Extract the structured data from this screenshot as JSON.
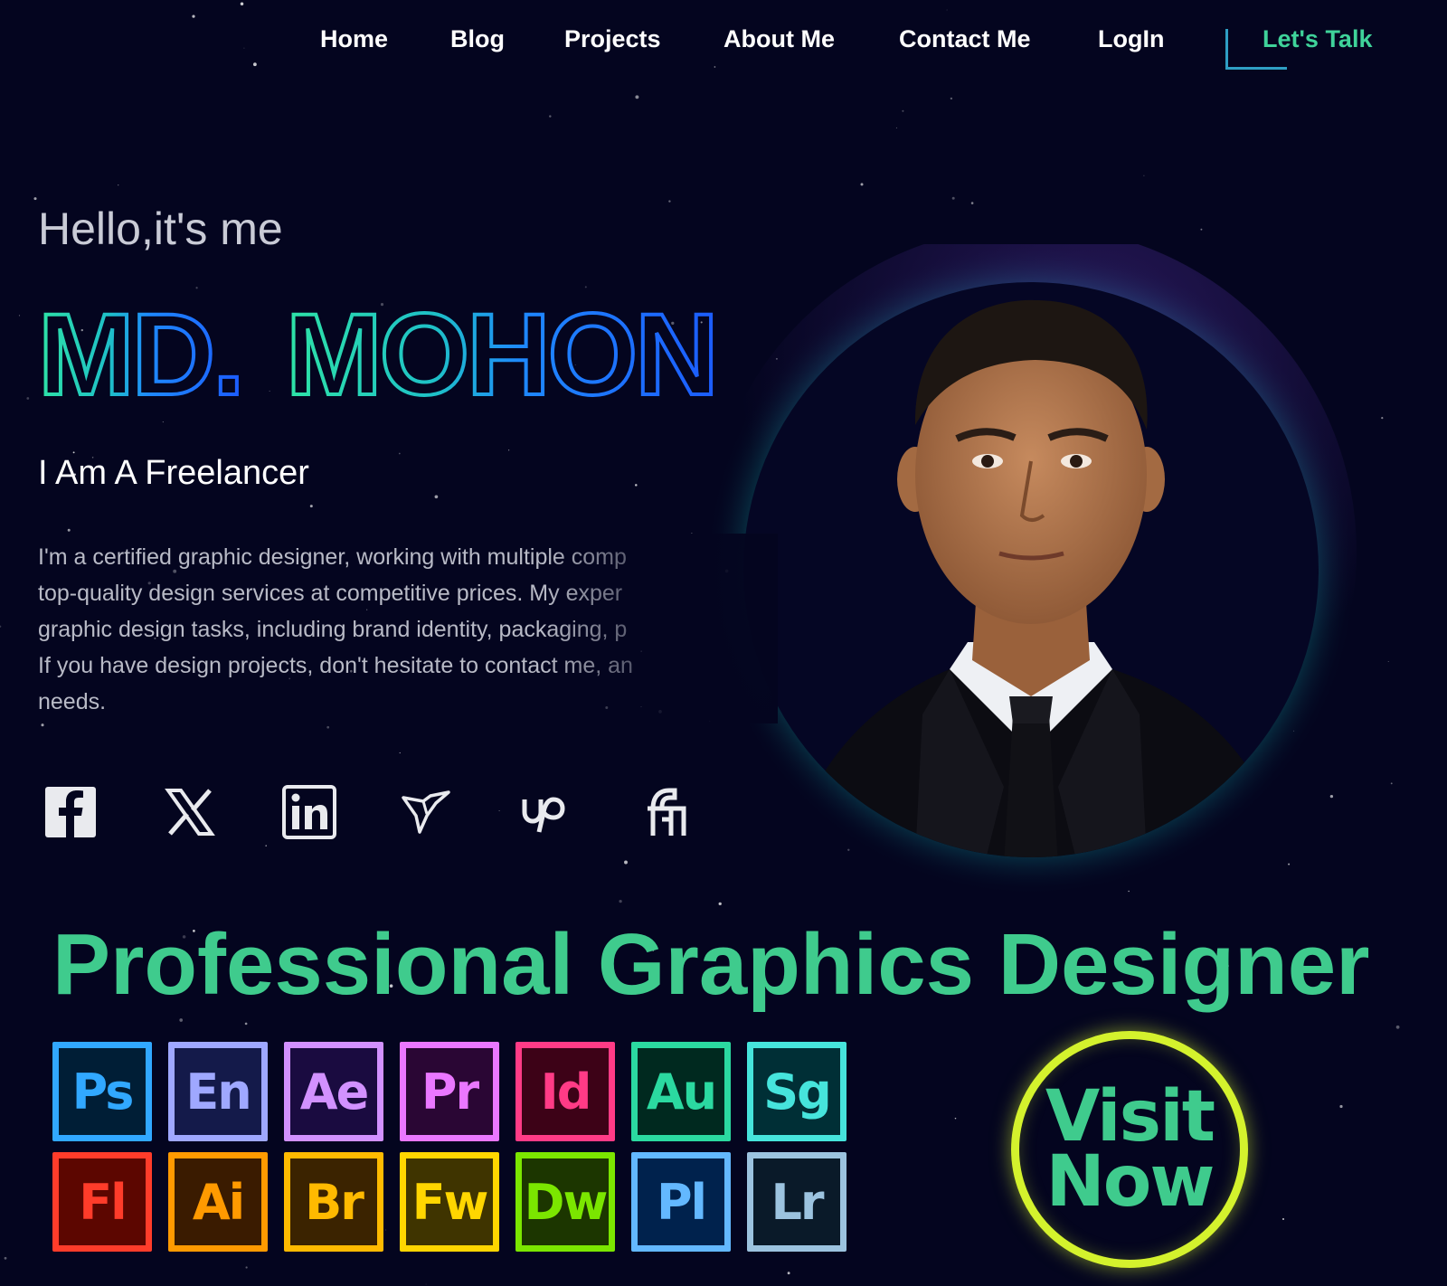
{
  "nav": {
    "items": [
      "Home",
      "Blog",
      "Projects",
      "About Me",
      "Contact Me",
      "LogIn"
    ],
    "cta_label": "Let's Talk"
  },
  "hero": {
    "greeting": "Hello,it's me",
    "name_first": "MD.",
    "name_last": "MOHON",
    "role": "I Am A Freelancer",
    "bio_lines": [
      "I'm a certified graphic designer, working with multiple comp",
      "top-quality design services at competitive prices. My exper",
      "graphic design tasks, including brand identity, packaging, p",
      "If you have design projects, don't hesitate to contact me, an",
      "needs."
    ]
  },
  "social": [
    "facebook-icon",
    "x-twitter-icon",
    "linkedin-icon",
    "freelancer-icon",
    "upwork-icon",
    "fiverr-icon"
  ],
  "headline": "Professional Graphics Designer",
  "apps": [
    {
      "abbr": "Ps",
      "color": "#31a8ff",
      "bg": "#001e36"
    },
    {
      "abbr": "En",
      "color": "#9fa8ff",
      "bg": "#141a4a"
    },
    {
      "abbr": "Ae",
      "color": "#d291ff",
      "bg": "#1a0b40"
    },
    {
      "abbr": "Pr",
      "color": "#ea77ff",
      "bg": "#2a0634"
    },
    {
      "abbr": "Id",
      "color": "#ff3b86",
      "bg": "#3d0217"
    },
    {
      "abbr": "Au",
      "color": "#2bd9a0",
      "bg": "#00291f"
    },
    {
      "abbr": "Sg",
      "color": "#46e4dc",
      "bg": "#002f36"
    },
    {
      "abbr": "Fl",
      "color": "#ff3c2a",
      "bg": "#5c0600"
    },
    {
      "abbr": "Ai",
      "color": "#ff9a00",
      "bg": "#3a1b00"
    },
    {
      "abbr": "Br",
      "color": "#ffba00",
      "bg": "#3b2300"
    },
    {
      "abbr": "Fw",
      "color": "#ffd600",
      "bg": "#3f3400"
    },
    {
      "abbr": "Dw",
      "color": "#7be600",
      "bg": "#1c3600"
    },
    {
      "abbr": "Pl",
      "color": "#63b8ff",
      "bg": "#00224d"
    },
    {
      "abbr": "Lr",
      "color": "#9cc3df",
      "bg": "#0a1a29"
    }
  ],
  "visit": {
    "line1": "Visit",
    "line2": "Now"
  },
  "colors": {
    "accent_green": "#3fcb8d",
    "visit_ring": "#d4f22d",
    "background": "#04051f"
  }
}
